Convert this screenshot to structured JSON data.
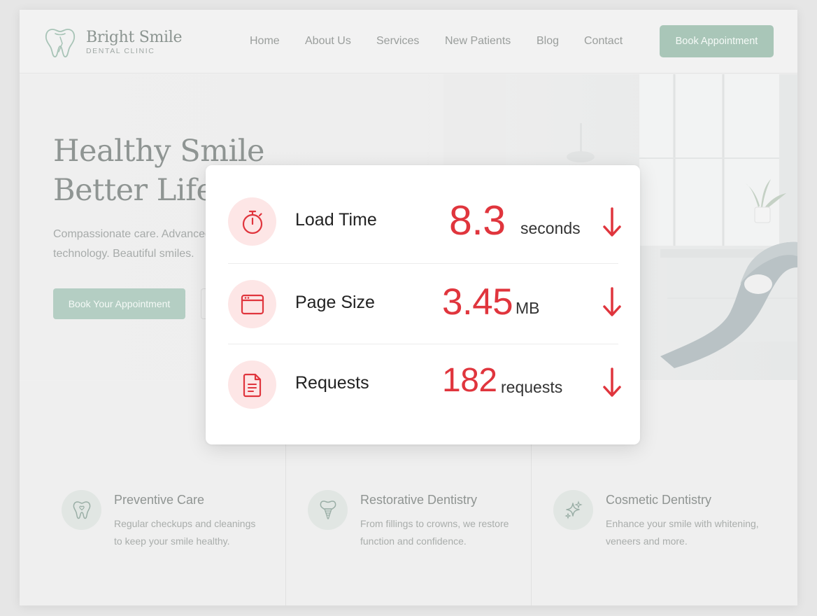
{
  "brand": {
    "name": "Bright Smile",
    "subtitle": "DENTAL CLINIC",
    "accent_color": "#a9c6b8",
    "icon": "tooth-icon"
  },
  "nav": {
    "items": [
      {
        "label": "Home"
      },
      {
        "label": "About Us"
      },
      {
        "label": "Services"
      },
      {
        "label": "New Patients"
      },
      {
        "label": "Blog"
      },
      {
        "label": "Contact"
      }
    ],
    "cta_label": "Book Appointment"
  },
  "hero": {
    "title_line1": "Healthy Smile",
    "title_line2": "Better Life",
    "subtitle_line1": "Compassionate care. Advanced",
    "subtitle_line2": "technology. Beautiful smiles.",
    "cta_label": "Book Your Appointment"
  },
  "services": [
    {
      "title": "Preventive Care",
      "desc_line1": "Regular checkups and cleanings",
      "desc_line2": "to keep your smile healthy.",
      "icon": "tooth-icon"
    },
    {
      "title": "Restorative Dentistry",
      "desc_line1": "From fillings to crowns, we restore",
      "desc_line2": "function and confidence.",
      "icon": "implant-icon"
    },
    {
      "title": "Cosmetic Dentistry",
      "desc_line1": "Enhance your smile with whitening,",
      "desc_line2": "veneers and more.",
      "icon": "sparkle-icon"
    }
  ],
  "metrics": {
    "alert_color": "#e0353d",
    "items": [
      {
        "label": "Load Time",
        "value": "8.3",
        "unit": "seconds",
        "icon": "stopwatch-icon",
        "trend_icon": "arrow-down-icon"
      },
      {
        "label": "Page Size",
        "value": "3.45",
        "unit": "MB",
        "icon": "browser-window-icon",
        "trend_icon": "arrow-down-icon"
      },
      {
        "label": "Requests",
        "value": "182",
        "unit": "requests",
        "icon": "document-icon",
        "trend_icon": "arrow-down-icon"
      }
    ]
  }
}
